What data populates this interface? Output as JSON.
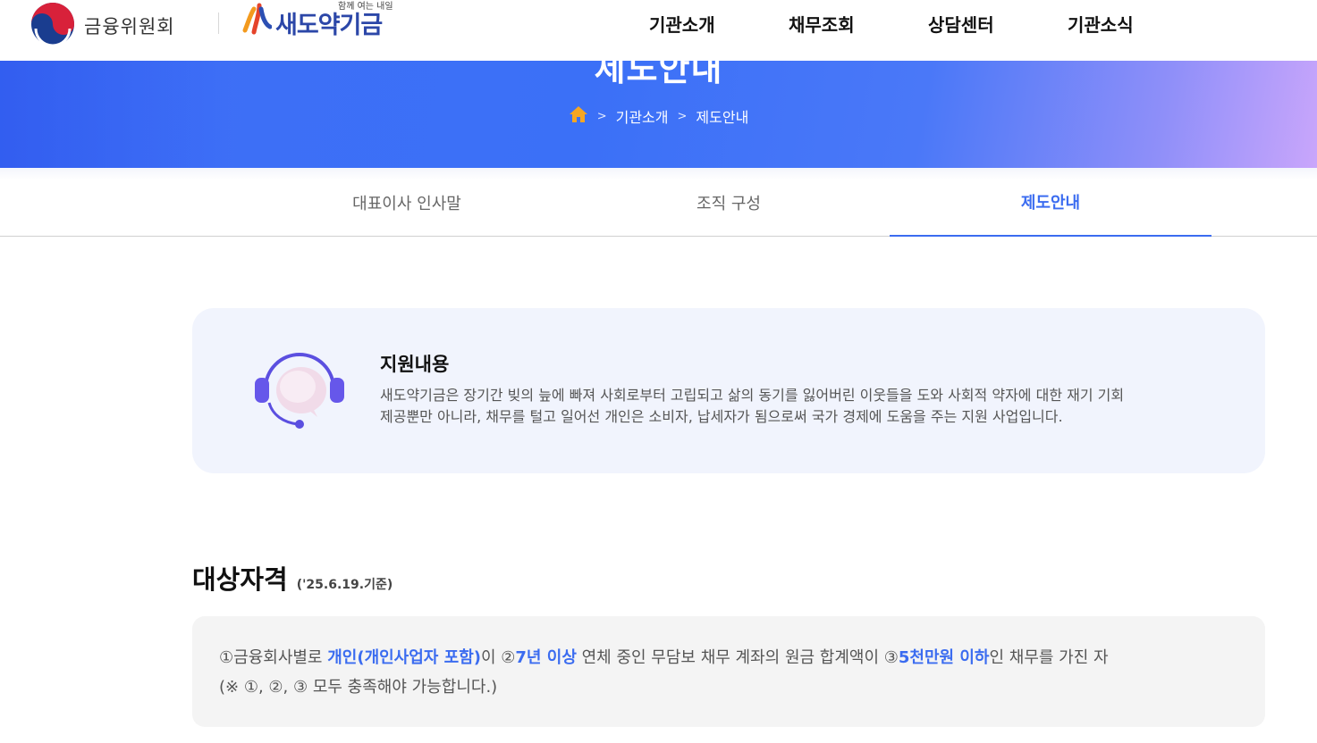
{
  "header": {
    "fsc_logo_label": "금융위원회",
    "fund_logo_slogan": "함께 여는 내일",
    "fund_logo_name": "새도약기금",
    "nav": [
      "기관소개",
      "채무조회",
      "상담센터",
      "기관소식"
    ]
  },
  "hero": {
    "title": "제도안내",
    "breadcrumb": [
      "기관소개",
      "제도안내"
    ],
    "breadcrumb_separator": ">"
  },
  "tabs": [
    {
      "label": "대표이사 인사말",
      "active": false
    },
    {
      "label": "조직 구성",
      "active": false
    },
    {
      "label": "제도안내",
      "active": true
    }
  ],
  "support": {
    "icon": "headset-chat-icon",
    "title": "지원내용",
    "line1": "새도약기금은 장기간 빚의 늪에 빠져 사회로부터 고립되고 삶의 동기를 잃어버린 이웃들을 도와 사회적 약자에 대한 재기 기회",
    "line2": "제공뿐만 아니라, 채무를 털고 일어선 개인은 소비자, 납세자가 됨으로써 국가 경제에 도움을 주는 지원 사업입니다."
  },
  "eligibility": {
    "title": "대상자격",
    "date": "('25.6.19.기준)",
    "seg1": "①금융회사별로 ",
    "hl1": "개인(개인사업자 포함)",
    "seg2": "이 ②",
    "hl2": "7년 이상",
    "seg3": " 연체 중인 무담보 채무 계좌의 원금 합계액이 ③",
    "hl3": "5천만원 이하",
    "seg4": "인 채무를 가진 자",
    "note": "(※ ①, ②, ③ 모두 충족해야 가능합니다.)"
  },
  "colors": {
    "accent": "#3b6cf0",
    "hero_start": "#3f6ef6",
    "hero_end": "#c9a6fb",
    "support_bg": "#f1f4fd",
    "eligibility_bg": "#f4f4f4"
  }
}
